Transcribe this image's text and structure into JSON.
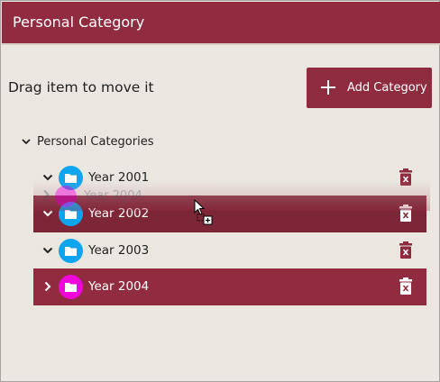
{
  "window": {
    "title": "Personal Category"
  },
  "toolbar": {
    "hint": "Drag item to move it",
    "add_label": "Add Category"
  },
  "tree": {
    "root_label": "Personal Categories",
    "items": [
      {
        "label": "Year 2001",
        "expanded": true,
        "folder_color": "#0ea5ef",
        "state": "normal"
      },
      {
        "label": "Year 2002",
        "expanded": true,
        "folder_color": "#0ea5ef",
        "state": "drop-target"
      },
      {
        "label": "Year 2003",
        "expanded": true,
        "folder_color": "#0ea5ef",
        "state": "normal"
      },
      {
        "label": "Year 2004",
        "expanded": false,
        "folder_color": "#ee08d9",
        "state": "selected"
      }
    ],
    "drag_ghost_label": "Year 2004"
  },
  "colors": {
    "accent": "#912c40",
    "background": "#ebe7e0",
    "folder_blue": "#0ea5ef",
    "folder_magenta": "#ee08d9"
  },
  "icons": {
    "add": "plus-icon",
    "delete": "trash-icon",
    "folder": "folder-icon",
    "expand": "chevron-icon"
  }
}
